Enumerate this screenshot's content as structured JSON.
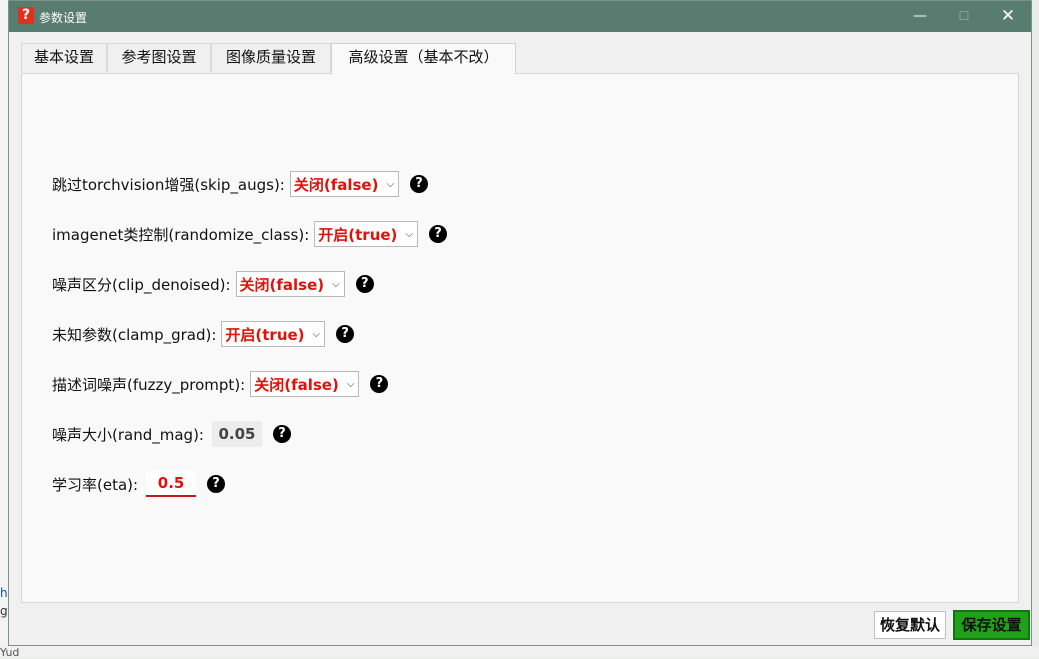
{
  "window": {
    "title": "参数设置",
    "icon_glyph": "?",
    "controls": {
      "minimize": "—",
      "maximize": "☐",
      "close": "✕"
    }
  },
  "background_fragments": {
    "left_a": "h",
    "left_b": "g",
    "bottom": "Yud"
  },
  "tabs": [
    {
      "label": "基本设置",
      "active": false
    },
    {
      "label": "参考图设置",
      "active": false
    },
    {
      "label": "图像质量设置",
      "active": false
    },
    {
      "label": "高级设置（基本不改）",
      "active": true
    }
  ],
  "settings": [
    {
      "label": "跳过torchvision增强(skip_augs):",
      "value": "关闭(false)",
      "type": "select"
    },
    {
      "label": "imagenet类控制(randomize_class):",
      "value": "开启(true)",
      "type": "select"
    },
    {
      "label": "噪声区分(clip_denoised):",
      "value": "关闭(false)",
      "type": "select"
    },
    {
      "label": "未知参数(clamp_grad):",
      "value": "开启(true)",
      "type": "select"
    },
    {
      "label": "描述词噪声(fuzzy_prompt):",
      "value": "关闭(false)",
      "type": "select"
    },
    {
      "label": "噪声大小(rand_mag):",
      "value": "0.05",
      "type": "readonly"
    },
    {
      "label": "学习率(eta):",
      "value": "0.5",
      "type": "input"
    }
  ],
  "help_glyph": "?",
  "chevron_glyph": "⌵",
  "buttons": {
    "restore": "恢复默认",
    "save": "保存设置"
  },
  "colors": {
    "titlebar": "#587c70",
    "value_red": "#e0120b",
    "save_green": "#1fa119"
  }
}
